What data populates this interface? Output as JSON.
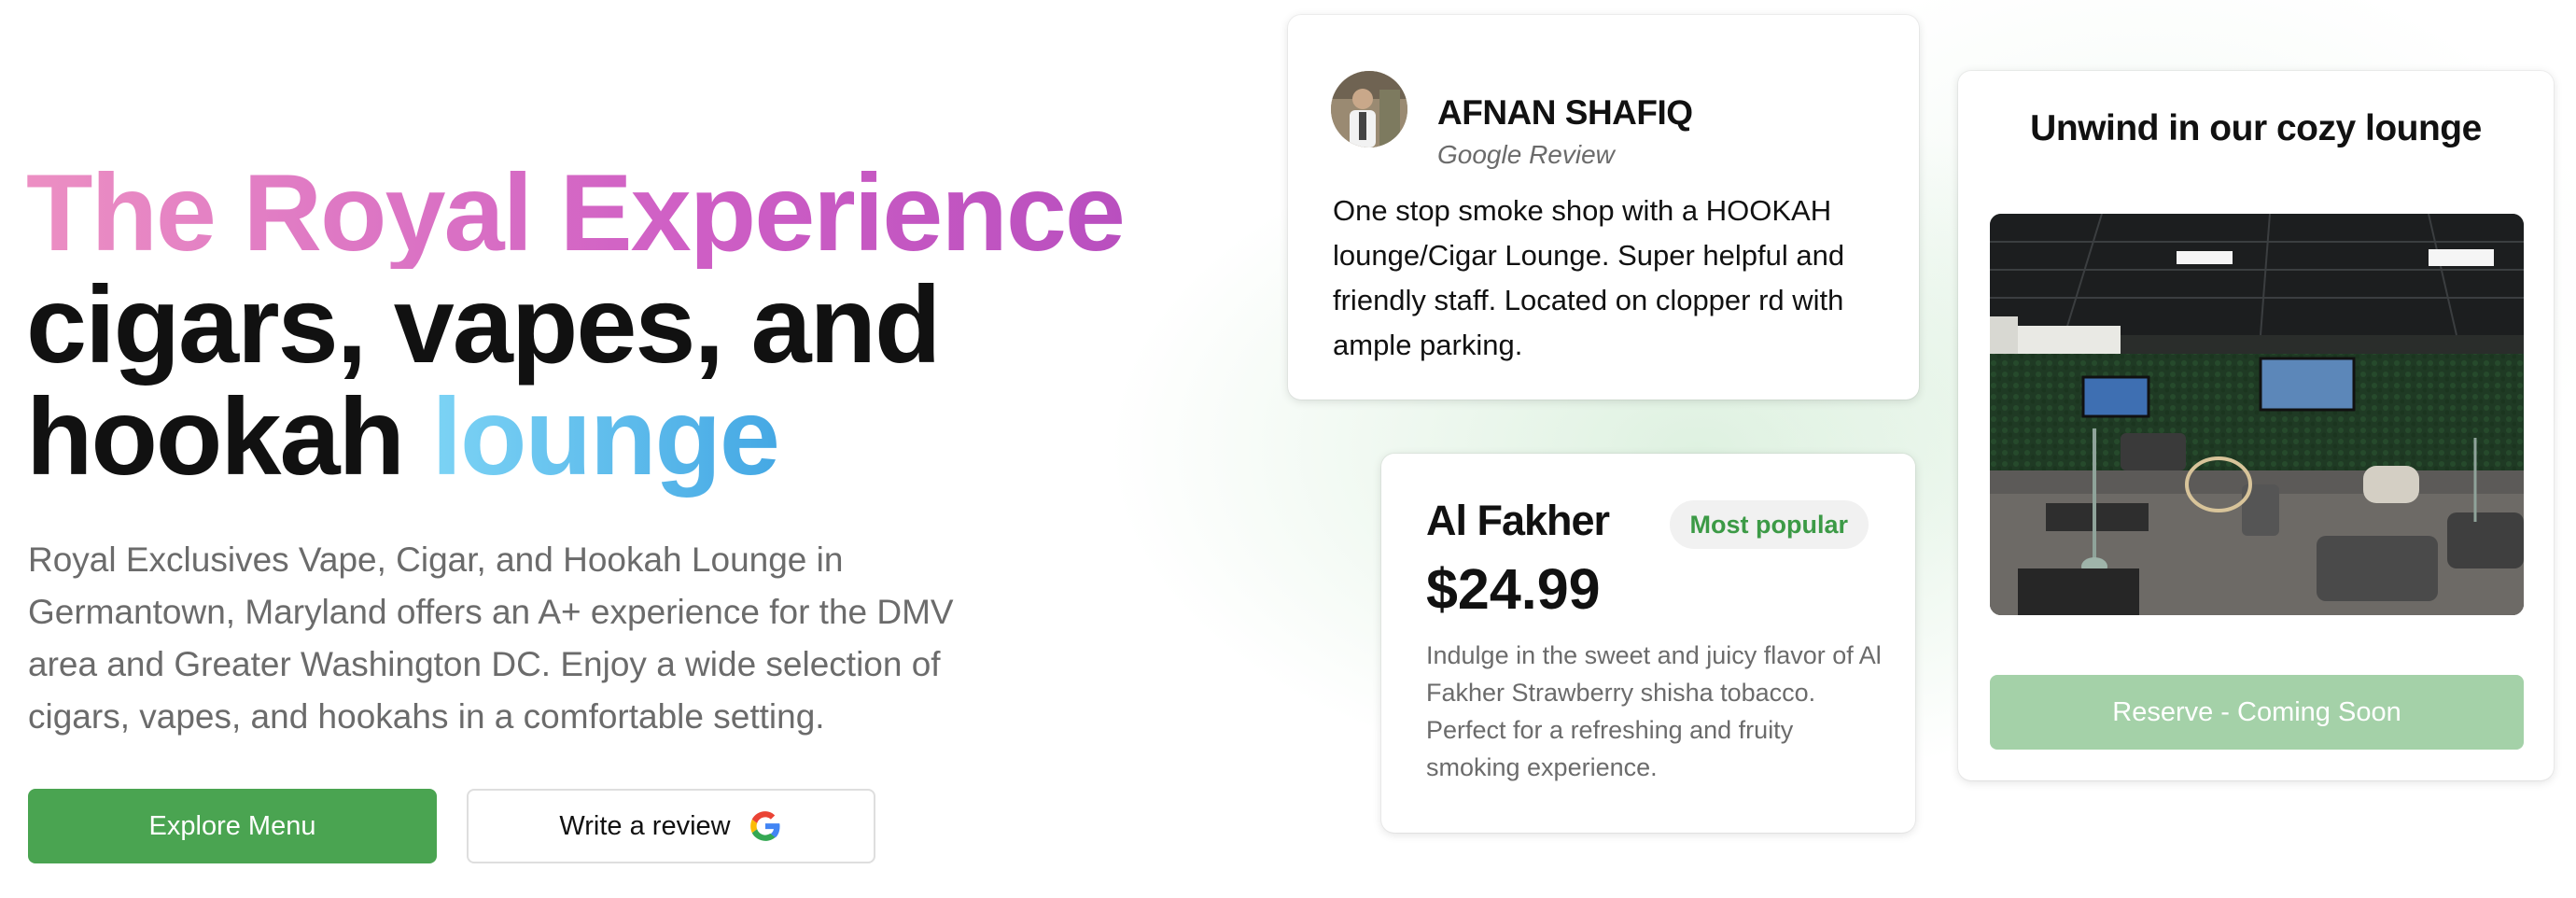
{
  "hero": {
    "title_line1": "The Royal Experience",
    "title_line2": "cigars, vapes, and",
    "title_line3_plain": "hookah ",
    "title_line3_accent": "lounge",
    "description": "Royal Exclusives Vape, Cigar, and Hookah Lounge in Germantown, Maryland offers an A+ experience for the DMV area and Greater Washington DC. Enjoy a wide selection of cigars, vapes, and hookahs in a comfortable setting.",
    "explore_button": "Explore Menu",
    "review_button": "Write a review",
    "review_button_icon": "google-icon"
  },
  "review": {
    "name": "AFNAN SHAFIQ",
    "source": "Google Review",
    "text": "One stop smoke shop with a HOOKAH lounge/Cigar Lounge. Super helpful and friendly staff. Located on clopper rd with ample parking."
  },
  "product": {
    "name": "Al Fakher",
    "badge": "Most popular",
    "price": "$24.99",
    "description": "Indulge in the sweet and juicy flavor of Al Fakher Strawberry shisha tobacco. Perfect for a refreshing and fruity smoking experience."
  },
  "lounge": {
    "title": "Unwind in our cozy lounge",
    "reserve_button": "Reserve - Coming Soon"
  },
  "colors": {
    "primary_green": "#4aa451",
    "disabled_green": "#a4d1a8",
    "badge_green": "#3c9a46",
    "title_pink": "#cf5fc5",
    "title_blue": "#45a8e4"
  }
}
